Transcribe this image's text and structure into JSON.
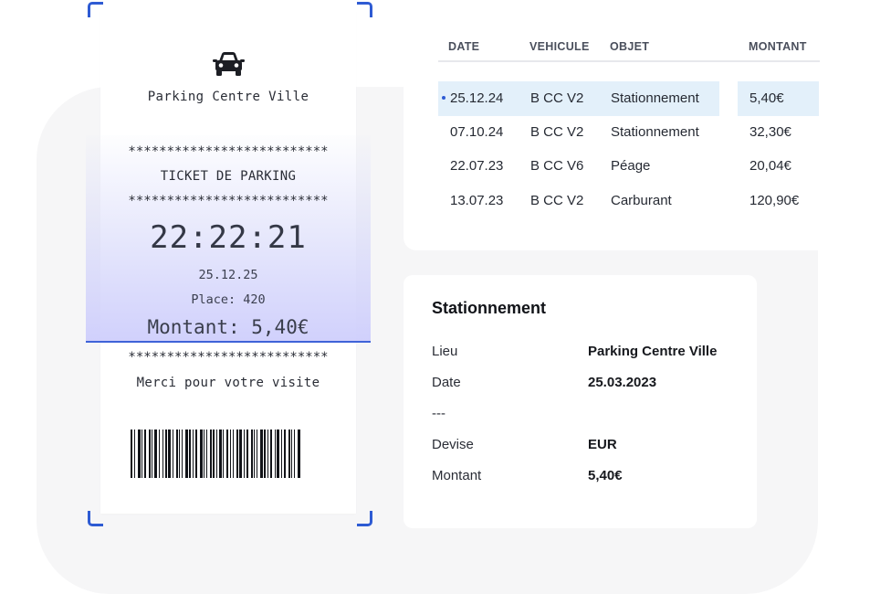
{
  "receipt": {
    "icon": "car-icon",
    "venue": "Parking Centre Ville",
    "stars_top": "**************************",
    "ticket_title": "TICKET DE PARKING",
    "stars_mid": "**************************",
    "time": "22:22:21",
    "date": "25.12.25",
    "place": "Place: 420",
    "amount": "Montant: 5,40€",
    "stars_bottom": "**************************",
    "thanks": "Merci pour votre visite"
  },
  "table": {
    "headers": [
      "DATE",
      "VEHICULE",
      "OBJET",
      "MONTANT"
    ],
    "rows": [
      {
        "date": "25.12.24",
        "vehicle": "B CC V2",
        "object": "Stationnement",
        "amount": "5,40€"
      },
      {
        "date": "07.10.24",
        "vehicle": "B CC V2",
        "object": "Stationnement",
        "amount": "32,30€"
      },
      {
        "date": "22.07.23",
        "vehicle": "B CC V6",
        "object": "Péage",
        "amount": "20,04€"
      },
      {
        "date": "13.07.23",
        "vehicle": "B CC V2",
        "object": "Carburant",
        "amount": "120,90€"
      }
    ]
  },
  "detail": {
    "title": "Stationnement",
    "fields": [
      {
        "label": "Lieu",
        "value": "Parking Centre Ville"
      },
      {
        "label": "Date",
        "value": "25.03.2023"
      },
      {
        "label": "---",
        "value": ""
      },
      {
        "label": "Devise",
        "value": "EUR"
      },
      {
        "label": "Montant",
        "value": "5,40€"
      }
    ]
  },
  "colors": {
    "accent": "#2e5bd3",
    "row_highlight": "#e3f0fa",
    "background_panel": "#f6f6f7"
  }
}
